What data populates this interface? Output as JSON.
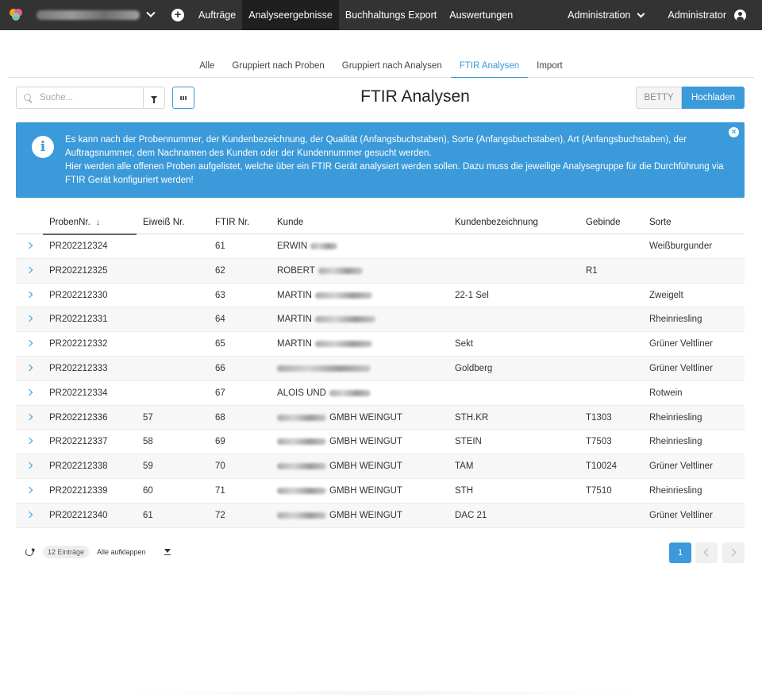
{
  "nav": {
    "items": [
      "Aufträge",
      "Analyseergebnisse",
      "Buchhaltungs Export",
      "Auswertungen"
    ],
    "active": "Analyseergebnisse",
    "administration": "Administration",
    "user": "Administrator"
  },
  "tabs": [
    "Alle",
    "Gruppiert nach Proben",
    "Gruppiert nach Analysen",
    "FTIR Analysen",
    "Import"
  ],
  "active_tab": "FTIR Analysen",
  "search": {
    "placeholder": "Suche..."
  },
  "page_title": "FTIR Analysen",
  "buttons": {
    "betty": "BETTY",
    "upload": "Hochladen"
  },
  "info": {
    "line1": "Es kann nach der Probennummer, der Kundenbezeichnung, der Qualität (Anfangsbuchstaben), Sorte (Anfangsbuchstaben), Art (Anfangsbuchstaben), der Auftragsnummer, dem Nachnamen des Kunden oder der Kundennummer gesucht werden.",
    "line2": "Hier werden alle offenen Proben aufgelistet, welche über ein FTIR Gerät analysiert werden sollen. Dazu muss die jeweilige Analysegruppe für die Durchführung via FTIR Gerät konfiguriert werden!"
  },
  "table": {
    "headers": {
      "probe": "ProbenNr.",
      "eiweiss": "Eiweiß Nr.",
      "ftir": "FTIR Nr.",
      "kunde": "Kunde",
      "kbez": "Kundenbezeichnung",
      "gebinde": "Gebinde",
      "sorte": "Sorte"
    },
    "sort_arrow": "↓",
    "rows": [
      {
        "probe": "PR202212324",
        "eiweiss": "",
        "ftir": "61",
        "kunde": "ERWIN",
        "kbez": "",
        "gebinde": "",
        "sorte": "Weißburgunder"
      },
      {
        "probe": "PR202212325",
        "eiweiss": "",
        "ftir": "62",
        "kunde": "ROBERT",
        "kbez": "",
        "gebinde": "R1",
        "sorte": ""
      },
      {
        "probe": "PR202212330",
        "eiweiss": "",
        "ftir": "63",
        "kunde": "MARTIN",
        "kbez": "22-1 Sel",
        "gebinde": "",
        "sorte": "Zweigelt"
      },
      {
        "probe": "PR202212331",
        "eiweiss": "",
        "ftir": "64",
        "kunde": "MARTIN",
        "kbez": "",
        "gebinde": "",
        "sorte": "Rheinriesling"
      },
      {
        "probe": "PR202212332",
        "eiweiss": "",
        "ftir": "65",
        "kunde": "MARTIN",
        "kbez": "Sekt",
        "gebinde": "",
        "sorte": "Grüner Veltliner"
      },
      {
        "probe": "PR202212333",
        "eiweiss": "",
        "ftir": "66",
        "kunde": "",
        "kbez": "Goldberg",
        "gebinde": "",
        "sorte": "Grüner Veltliner"
      },
      {
        "probe": "PR202212334",
        "eiweiss": "",
        "ftir": "67",
        "kunde": "ALOIS UND",
        "kbez": "",
        "gebinde": "",
        "sorte": "Rotwein"
      },
      {
        "probe": "PR202212336",
        "eiweiss": "57",
        "ftir": "68",
        "kunde": "GMBH WEINGUT",
        "kbez": "STH.KR",
        "gebinde": "T1303",
        "sorte": "Rheinriesling"
      },
      {
        "probe": "PR202212337",
        "eiweiss": "58",
        "ftir": "69",
        "kunde": "GMBH WEINGUT",
        "kbez": "STEIN",
        "gebinde": "T7503",
        "sorte": "Rheinriesling"
      },
      {
        "probe": "PR202212338",
        "eiweiss": "59",
        "ftir": "70",
        "kunde": "GMBH WEINGUT",
        "kbez": "TAM",
        "gebinde": "T10024",
        "sorte": "Grüner Veltliner"
      },
      {
        "probe": "PR202212339",
        "eiweiss": "60",
        "ftir": "71",
        "kunde": "GMBH WEINGUT",
        "kbez": "STH",
        "gebinde": "T7510",
        "sorte": "Rheinriesling"
      },
      {
        "probe": "PR202212340",
        "eiweiss": "61",
        "ftir": "72",
        "kunde": "GMBH WEINGUT",
        "kbez": "DAC 21",
        "gebinde": "",
        "sorte": "Grüner Veltliner"
      }
    ]
  },
  "footer": {
    "count": "12 Einträge",
    "expand_all": "Alle aufklappen",
    "page": "1"
  },
  "colors": {
    "accent": "#3b9ad9",
    "topbar": "#333333"
  }
}
